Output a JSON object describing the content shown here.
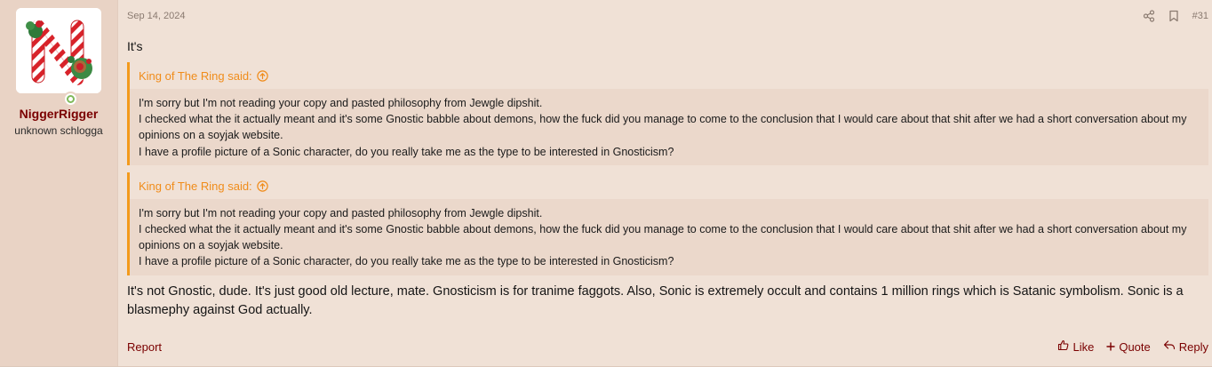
{
  "post": {
    "author": {
      "username": "NiggerRigger",
      "user_title": "unknown schlogga"
    },
    "date": "Sep 14, 2024",
    "post_number": "#31",
    "intro": "It's",
    "quotes": [
      {
        "attribution": "King of The Ring said:",
        "lines": [
          "I'm sorry but I'm not reading your copy and pasted philosophy from Jewgle dipshit.",
          "I checked what the it actually meant and it's some Gnostic babble about demons, how the fuck did you manage to come to the conclusion that I would care about that shit after we had a short conversation about my opinions on a soyjak website.",
          "I have a profile picture of a Sonic character, do you really take me as the type to be interested in Gnosticism?"
        ]
      },
      {
        "attribution": "King of The Ring said:",
        "lines": [
          "I'm sorry but I'm not reading your copy and pasted philosophy from Jewgle dipshit.",
          "I checked what the it actually meant and it's some Gnostic babble about demons, how the fuck did you manage to come to the conclusion that I would care about that shit after we had a short conversation about my opinions on a soyjak website.",
          "I have a profile picture of a Sonic character, do you really take me as the type to be interested in Gnosticism?"
        ]
      }
    ],
    "reply": "It's not Gnostic, dude. It's just good old lecture, mate. Gnosticism is for tranime faggots. Also, Sonic is extremely occult and contains 1 million rings which is Satanic symbolism. Sonic is a blasmephy against God actually.",
    "actions": {
      "report": "Report",
      "like": "Like",
      "quote": "Quote",
      "reply": "Reply"
    }
  },
  "colors": {
    "accent": "#f08c1a",
    "username": "#7a0000",
    "background": "#f0e1d6",
    "sidebar": "#e9d3c5",
    "quote_background": "#ebd8cb"
  },
  "icons": {
    "share": "share-icon",
    "bookmark": "bookmark-icon",
    "quote_jump": "arrow-up-circle-icon",
    "like": "thumbs-up-icon",
    "quote": "plus-icon",
    "reply": "reply-arrow-icon",
    "online": "online-status-icon"
  }
}
